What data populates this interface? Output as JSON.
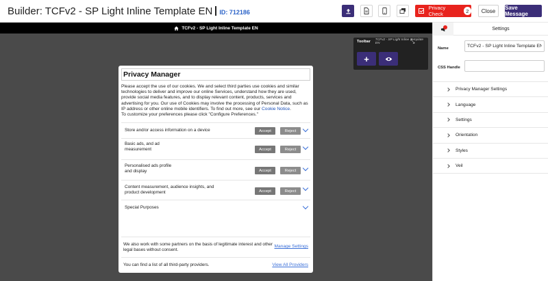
{
  "header": {
    "title": "Builder: TCFv2 - SP Light Inline Template EN",
    "id_label": "ID: 712186",
    "privacy_check_label": "Privacy Check",
    "privacy_check_count": "2",
    "close_label": "Close",
    "save_label": "Save Message",
    "icons": [
      "upload-icon",
      "document-icon",
      "mobile-icon",
      "layers-icon"
    ]
  },
  "canvas": {
    "template_name": "TCFv2 - SP Light Inline Template EN",
    "toolbar": {
      "label": "Toolbar",
      "template_name": "TCFv2 - SP Light Inline Template EN"
    }
  },
  "modal": {
    "title": "Privacy Manager",
    "intro_before_link": "Please accept the use of our cookies. We and select third parties use cookies and similar technologies to deliver and improve our online Services, understand how they are used, provide social media features, and to display relevant content, products, services and advertising for you. Our use of Cookies may involve the processing of Personal Data, such as IP address or other online mobile identifiers. To find out more, see our ",
    "intro_link": "Cookie Notice",
    "intro_after_link": ".",
    "intro_line2": "To customize your preferences please click \"Configure Preferences.\"",
    "accept_label": "Accept",
    "reject_label": "Reject",
    "purposes": [
      {
        "line1": "Store and/or access information on a device",
        "line2": ""
      },
      {
        "line1": "Basic ads, and ad",
        "line2": "measurement"
      },
      {
        "line1": "Personalised ads profile",
        "line2": "and display"
      },
      {
        "line1": "Content measurement, audience insights, and",
        "line2": "product development"
      }
    ],
    "special_purposes": "Special Purposes",
    "legit_line1": "We also work with some partners on the basis of legitimate interest and other",
    "legit_line2": "legal bases without consent.",
    "manage_settings": "Manage Settings",
    "providers_text": "You can find a list of all third-party providers.",
    "view_all_providers": "View All Providers"
  },
  "panel": {
    "tab_label": "Settings",
    "name_label": "Name",
    "name_value": "TCFv2 - SP Light Inline Template EN",
    "css_label": "CSS Handle",
    "css_value": "",
    "sections": [
      "Privacy Manager Settings",
      "Language",
      "Settings",
      "Orientation",
      "Styles",
      "Veil"
    ]
  },
  "colors": {
    "brand": "#3b2e78",
    "alert": "#e8231d",
    "link": "#3a6fd8",
    "canvas_bg": "#4a4a4a"
  }
}
